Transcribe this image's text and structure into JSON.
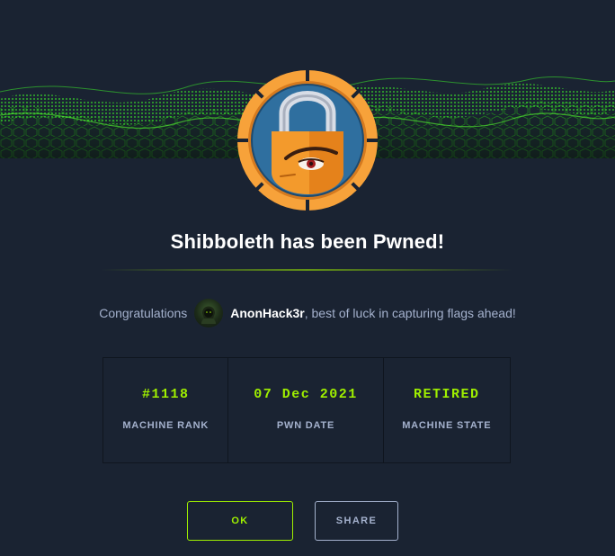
{
  "modal": {
    "title": "Shibboleth has been Pwned!",
    "congrats_prefix": "Congratulations",
    "username": "AnonHack3r",
    "congrats_suffix": ", best of luck in capturing flags ahead!",
    "avatar_icon": "hacker-avatar-icon",
    "badge_icon": "padlock-mascot-icon"
  },
  "stats": [
    {
      "value": "#1118",
      "label": "MACHINE RANK"
    },
    {
      "value": "07 Dec 2021",
      "label": "PWN DATE"
    },
    {
      "value": "RETIRED",
      "label": "MACHINE STATE"
    }
  ],
  "buttons": {
    "ok": "OK",
    "share": "SHARE"
  },
  "colors": {
    "background": "#1a2332",
    "accent": "#9fef00",
    "badge_ring": "#f7a23a",
    "text_muted": "#a4b1cd"
  }
}
